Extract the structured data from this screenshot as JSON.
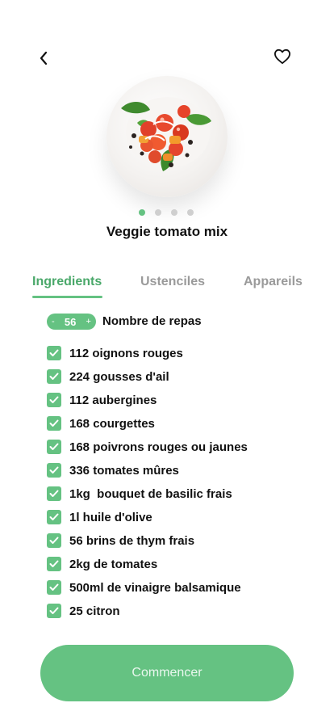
{
  "header": {
    "back_icon": "chevron-left-icon",
    "favorite_icon": "heart-outline-icon"
  },
  "recipe": {
    "title": "Veggie tomato mix",
    "image_name": "veggie-tomato-dish",
    "carousel": {
      "total": 4,
      "active_index": 0
    }
  },
  "tabs": [
    {
      "label": "Ingredients",
      "active": true
    },
    {
      "label": "Ustenciles",
      "active": false
    },
    {
      "label": "Appareils",
      "active": false
    }
  ],
  "servings": {
    "minus": "-",
    "value": "56",
    "plus": "+",
    "label": "Nombre de repas"
  },
  "ingredients": [
    {
      "text": "112 oignons rouges",
      "checked": true
    },
    {
      "text": "224 gousses d'ail",
      "checked": true
    },
    {
      "text": "112 aubergines",
      "checked": true
    },
    {
      "text": "168 courgettes",
      "checked": true
    },
    {
      "text": "168 poivrons rouges ou jaunes",
      "checked": true
    },
    {
      "text": "336 tomates mûres",
      "checked": true
    },
    {
      "text": "1kg  bouquet de basilic frais",
      "checked": true
    },
    {
      "text": "1l huile d'olive",
      "checked": true
    },
    {
      "text": "56 brins de thym frais",
      "checked": true
    },
    {
      "text": "2kg de tomates",
      "checked": true
    },
    {
      "text": "500ml de vinaigre balsamique",
      "checked": true
    },
    {
      "text": "25 citron",
      "checked": true
    }
  ],
  "cta": {
    "label": "Commencer"
  },
  "colors": {
    "accent": "#65c282",
    "accent_text": "#4aa86a",
    "muted": "#9a9a9a"
  }
}
